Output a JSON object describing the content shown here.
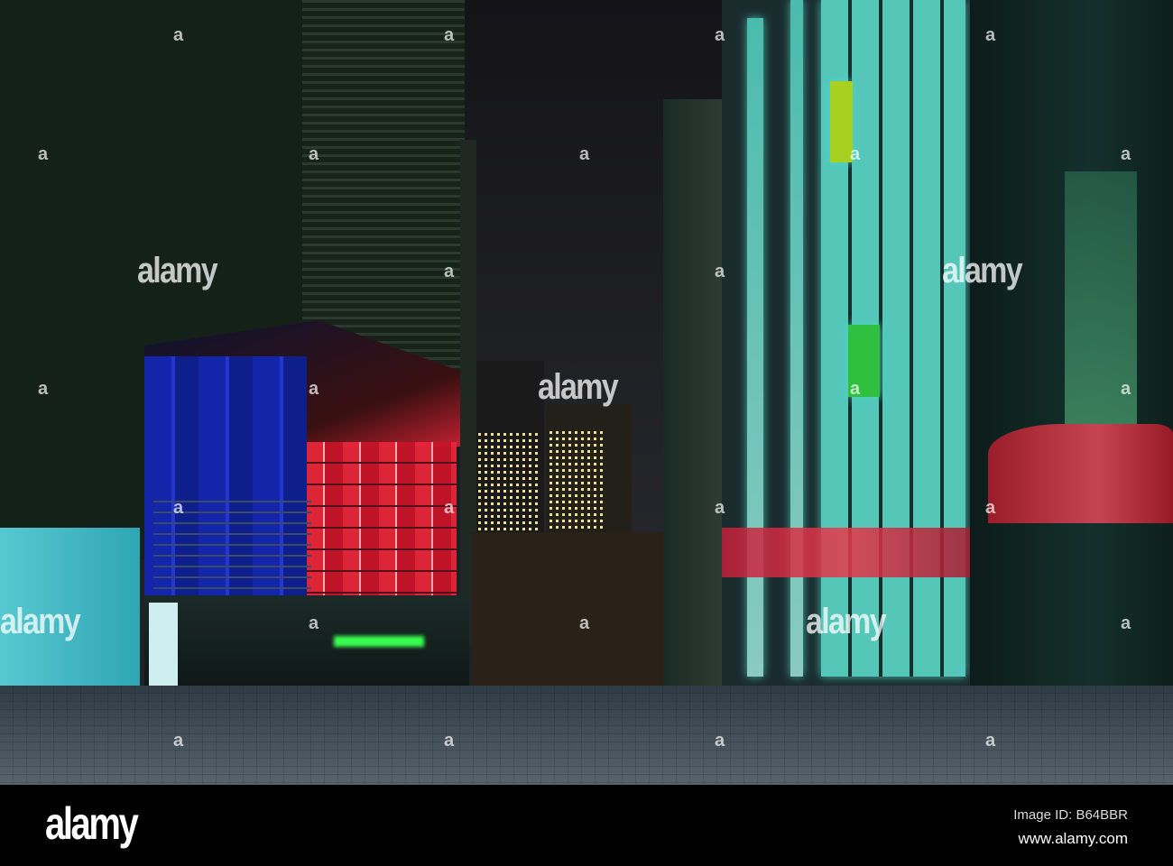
{
  "photo": {
    "subject": "Night view of modern buildings with illuminated coloured glass along a paved street",
    "colors": {
      "red_glass": "#e8263a",
      "blue_glass": "#1325a8",
      "cyan_windows": "#57e0cf",
      "sky": "#1c1d22"
    }
  },
  "watermark": {
    "text": "alamy",
    "mark": "a"
  },
  "footer": {
    "logo": "alamy",
    "image_id": "Image ID: B64BBR",
    "url": "www.alamy.com"
  }
}
